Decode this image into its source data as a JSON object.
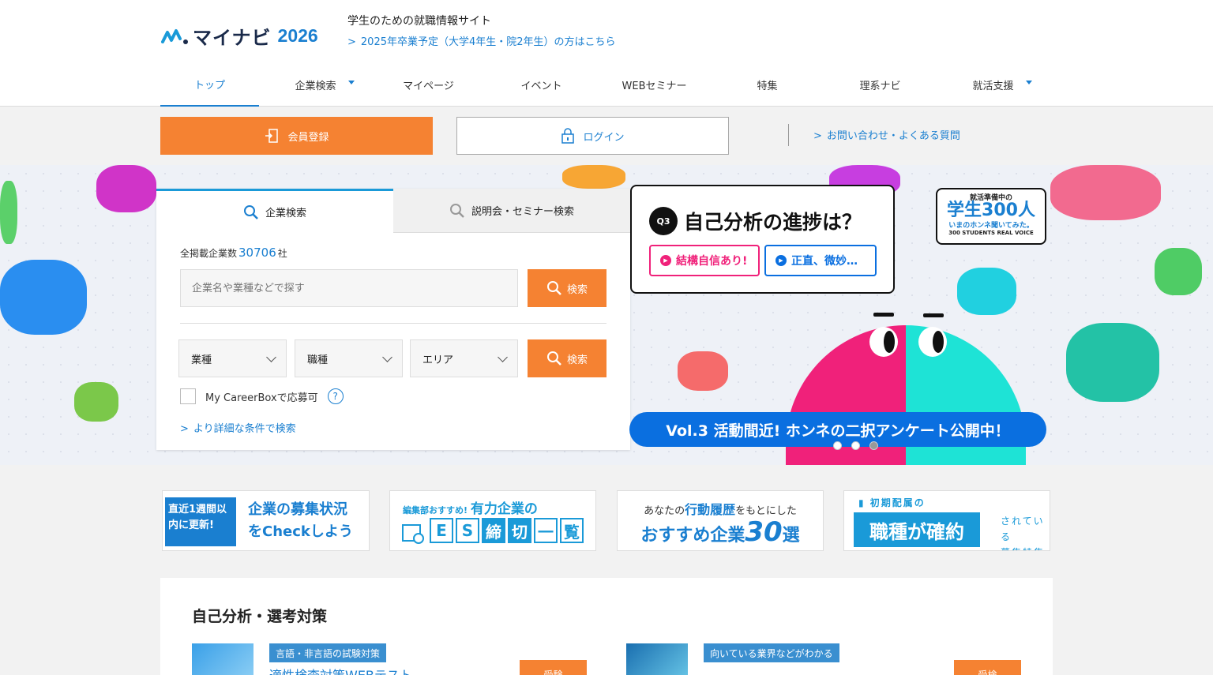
{
  "header": {
    "logo_text": "マイナビ",
    "logo_year": "2026",
    "tagline": "学生のための就職情報サイト",
    "grad_link": "2025年卒業予定（大学4年生・院2年生）の方はこちら"
  },
  "nav": {
    "items": [
      {
        "label": "トップ"
      },
      {
        "label": "企業検索"
      },
      {
        "label": "マイページ"
      },
      {
        "label": "イベント"
      },
      {
        "label": "WEBセミナー"
      },
      {
        "label": "特集"
      },
      {
        "label": "理系ナビ"
      },
      {
        "label": "就活支援"
      }
    ]
  },
  "actions": {
    "register": "会員登録",
    "login": "ログイン",
    "faq": "お問い合わせ・よくある質問"
  },
  "search": {
    "tab_company": "企業検索",
    "tab_seminar": "説明会・セミナー検索",
    "count_prefix": "全掲載企業数",
    "count": "30706",
    "count_suffix": "社",
    "keyword_placeholder": "企業名や業種などで探す",
    "search_button": "検索",
    "select_industry": "業種",
    "select_job": "職種",
    "select_area": "エリア",
    "careerbox_label": "My CareerBoxで応募可",
    "detail_link": "より詳細な条件で検索"
  },
  "hero": {
    "q_badge": "Q3",
    "q_title": "自己分析の進捗は？",
    "option1": "結構自信あり!",
    "option2": "正直、微妙…",
    "badge_top": "就活準備中の",
    "badge_main": "学生300人",
    "badge_sub": "いまのホンネ聞いてみた。",
    "badge_en": "300 STUDENTS REAL VOICE",
    "vol_text": "Vol.3  活動間近! ホンネの二択アンケート公開中！"
  },
  "promos": {
    "p1_tag": "直近1週間以内に更新!",
    "p1_main_line1": "企業の募集状況",
    "p1_main_line2": "をCheckしよう",
    "p2_top_small": "編集部おすすめ!",
    "p2_top_big": "有力企業の",
    "p2_chars": [
      "E",
      "S",
      "締",
      "切",
      "一",
      "覧"
    ],
    "p3_top_pre": "あなたの",
    "p3_top_hl": "行動履歴",
    "p3_top_post": "をもとにした",
    "p3_main_pre": "おすすめ企業",
    "p3_main_num": "30",
    "p3_main_post": "選",
    "p4_top": "初期配属の",
    "p4_main": "職種が確約",
    "p4_side1": "されている",
    "p4_side2": "募集特集"
  },
  "section": {
    "title": "自己分析・選考対策",
    "card1_tag": "言語・非言語の試験対策",
    "card1_title": "適性検査対策WEBテスト",
    "card1_btn": "受験",
    "card2_tag": "向いている業界などがわかる",
    "card2_btn": "受検"
  }
}
